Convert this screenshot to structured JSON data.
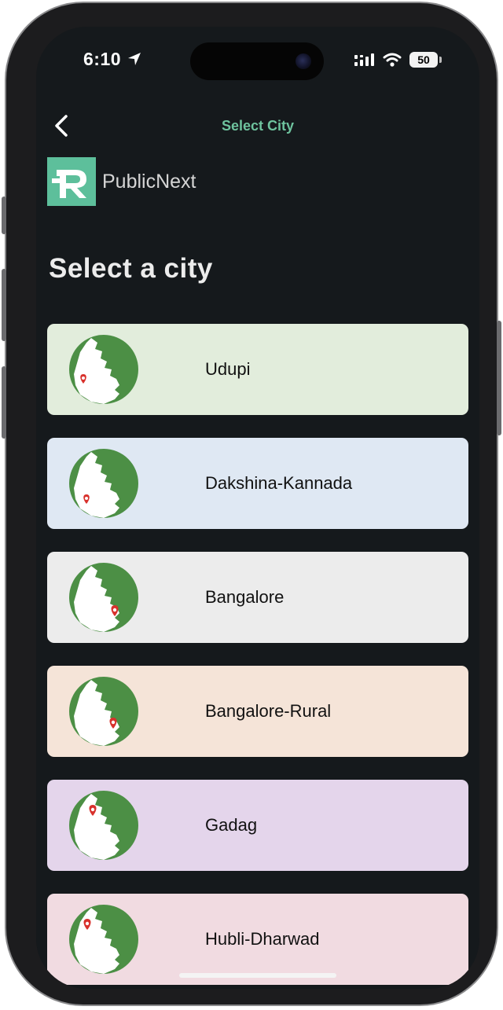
{
  "status_bar": {
    "time": "6:10",
    "battery": "50"
  },
  "nav": {
    "title": "Select City"
  },
  "brand": {
    "name": "PublicNext"
  },
  "heading": "Select a city",
  "cities": [
    {
      "name": "Udupi",
      "bg": "#e2eddc"
    },
    {
      "name": "Dakshina-Kannada",
      "bg": "#dfe8f3"
    },
    {
      "name": "Bangalore",
      "bg": "#ececec"
    },
    {
      "name": "Bangalore-Rural",
      "bg": "#f5e4d8"
    },
    {
      "name": "Gadag",
      "bg": "#e4d5eb"
    },
    {
      "name": "Hubli-Dharwad",
      "bg": "#f1dbe1"
    }
  ],
  "colors": {
    "accent": "#6ec39e",
    "logo": "#5dbf9b",
    "map_green": "#4c8f45",
    "pin": "#d8312c"
  }
}
